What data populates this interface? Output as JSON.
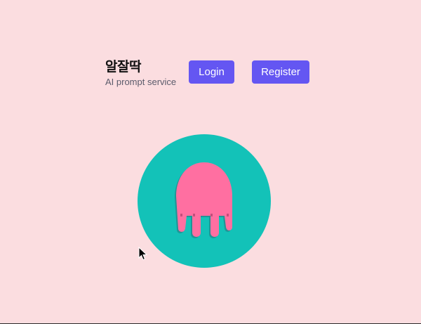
{
  "header": {
    "brand_title": "알잘딱",
    "brand_subtitle": "AI prompt service",
    "login_label": "Login",
    "register_label": "Register"
  },
  "icons": {
    "mascot": "jellyfish-icon",
    "cursor": "mouse-pointer-icon"
  },
  "colors": {
    "background": "#fbdde0",
    "accent": "#6456f2",
    "circle": "#13c2b8",
    "jellyfish": "#ff6fa1"
  }
}
